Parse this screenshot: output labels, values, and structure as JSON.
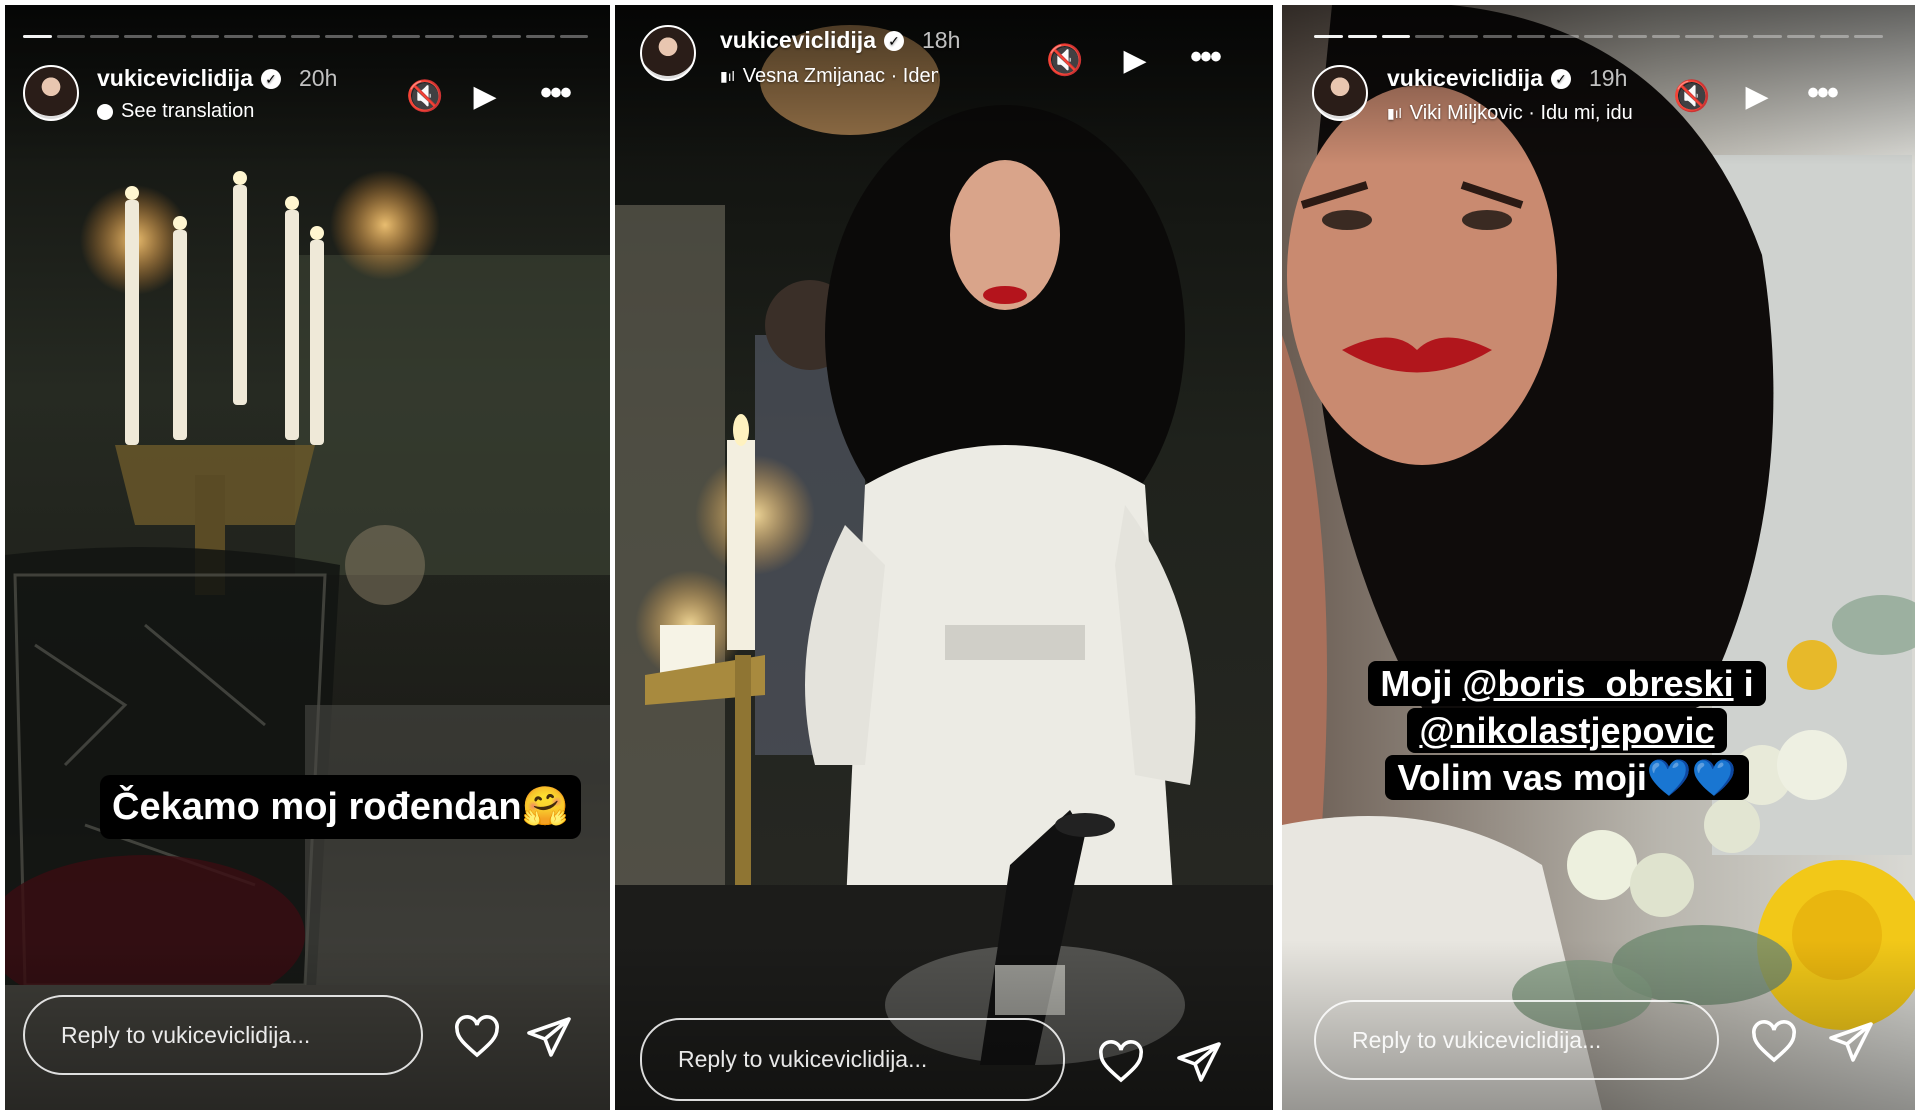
{
  "stories": [
    {
      "username": "vukiceviclidija",
      "time": "20h",
      "subtitle": "See translation",
      "caption": "Čekamo moj rođendan🤗",
      "reply_placeholder": "Reply to vukiceviclidija...",
      "progress": {
        "segments": 17,
        "viewed": 1
      }
    },
    {
      "username": "vukiceviclidija",
      "time": "18h",
      "music": "Vesna Zmijanac · Idem pr",
      "reply_placeholder": "Reply to vukiceviclidija..."
    },
    {
      "username": "vukiceviclidija",
      "time": "19h",
      "music": "Viki Miljkovic · Idu mi, idu",
      "caption_prefix": "Moji ",
      "mention1": "@boris_obreski",
      "caption_mid": " i",
      "mention2": "@nikolastjepovic",
      "caption_end": "Volim vas moji💙💙",
      "reply_placeholder": "Reply to vukiceviclidija...",
      "progress": {
        "segments": 17,
        "viewed": 3
      }
    }
  ],
  "icons": {
    "mute": "muted-speaker-icon",
    "play": "play-icon",
    "more": "more-options-icon",
    "heart": "heart-icon",
    "send": "send-icon",
    "translate": "globe-icon",
    "music": "music-bars-icon",
    "verified": "verified-badge-icon"
  },
  "glyphs": {
    "mute": "🔇",
    "play": "▶",
    "more": "•••",
    "verified": "✓",
    "music": "▮ıl"
  }
}
